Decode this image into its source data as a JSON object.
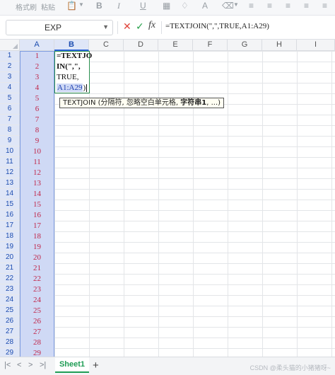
{
  "ribbon": {
    "labels": [
      "格式刷",
      "粘贴"
    ],
    "format_icons": [
      "B",
      "I",
      "U",
      "A",
      "A",
      "⌫"
    ]
  },
  "formula_bar": {
    "name_box": "EXP",
    "formula": "=TEXTJOIN(\",\",TRUE,A1:A29)"
  },
  "columns": [
    "A",
    "B",
    "C",
    "D",
    "E",
    "F",
    "G",
    "H",
    "I"
  ],
  "rows": [
    "1",
    "2",
    "3",
    "4",
    "5",
    "6",
    "7",
    "8",
    "9",
    "10",
    "11",
    "12",
    "13",
    "14",
    "15",
    "16",
    "17",
    "18",
    "19",
    "20",
    "21",
    "22",
    "23",
    "24",
    "25",
    "26",
    "27",
    "28",
    "29"
  ],
  "column_a_values": [
    "1",
    "2",
    "3",
    "4",
    "5",
    "6",
    "7",
    "8",
    "9",
    "10",
    "11",
    "12",
    "13",
    "14",
    "15",
    "16",
    "17",
    "18",
    "19",
    "20",
    "21",
    "22",
    "23",
    "24",
    "25",
    "26",
    "27",
    "28",
    "29"
  ],
  "edit_cell": {
    "line1": "=TEXTJO",
    "line2": "IN(\",\",",
    "line3": "TRUE,",
    "line4": "A1:A29",
    "line4_close": ")"
  },
  "tooltip": {
    "prefix": "TEXTJOIN (分隔符, 忽略空白单元格, ",
    "bold": "字符串1",
    "suffix": ", ...)"
  },
  "sheet_tabs": {
    "active": "Sheet1",
    "add": "+"
  },
  "watermark": "CSDN @柔头猫的小猪猪呀~",
  "colors": {
    "selection_fill": "#cfd9f5",
    "selection_border": "#7d9be0",
    "number_text": "#c0274a",
    "edit_border": "#2a8f4e",
    "tab_accent": "#1f9d55"
  }
}
